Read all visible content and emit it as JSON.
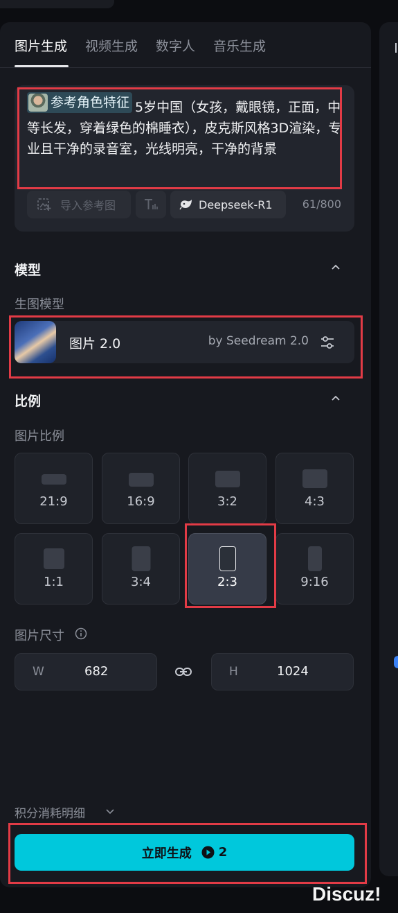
{
  "tabs": [
    {
      "label": "图片生成",
      "active": true
    },
    {
      "label": "视频生成",
      "active": false
    },
    {
      "label": "数字人",
      "active": false
    },
    {
      "label": "音乐生成",
      "active": false
    }
  ],
  "prompt": {
    "reference_chip": "参考角色特征",
    "text": "5岁中国（女孩，戴眼镜，正面，中等长发，穿着绿色的棉睡衣），皮克斯风格3D渲染，专业且干净的录音室，光线明亮，干净的背景",
    "import_ref_label": "导入参考图",
    "model_label": "Deepseek-R1",
    "counter": "61/800"
  },
  "model_section": {
    "title": "模型",
    "sub_label": "生图模型",
    "model_name": "图片 2.0",
    "model_by": "by Seedream 2.0"
  },
  "ratio_section": {
    "title": "比例",
    "sub_label": "图片比例",
    "ratios": [
      {
        "label": "21:9",
        "selected": false
      },
      {
        "label": "16:9",
        "selected": false
      },
      {
        "label": "3:2",
        "selected": false
      },
      {
        "label": "4:3",
        "selected": false
      },
      {
        "label": "1:1",
        "selected": false
      },
      {
        "label": "3:4",
        "selected": false
      },
      {
        "label": "2:3",
        "selected": true
      },
      {
        "label": "9:16",
        "selected": false
      }
    ]
  },
  "size_section": {
    "label": "图片尺寸",
    "width_prefix": "W",
    "width_value": "682",
    "height_prefix": "H",
    "height_value": "1024"
  },
  "footer": {
    "cost_detail": "积分消耗明细",
    "generate_label": "立即生成",
    "generate_cost": "2"
  },
  "watermark": "Discuz!",
  "colors": {
    "background": "#0c0d11",
    "panel": "#17191f",
    "accent": "#00c8dc",
    "annotation": "#e23b46"
  }
}
